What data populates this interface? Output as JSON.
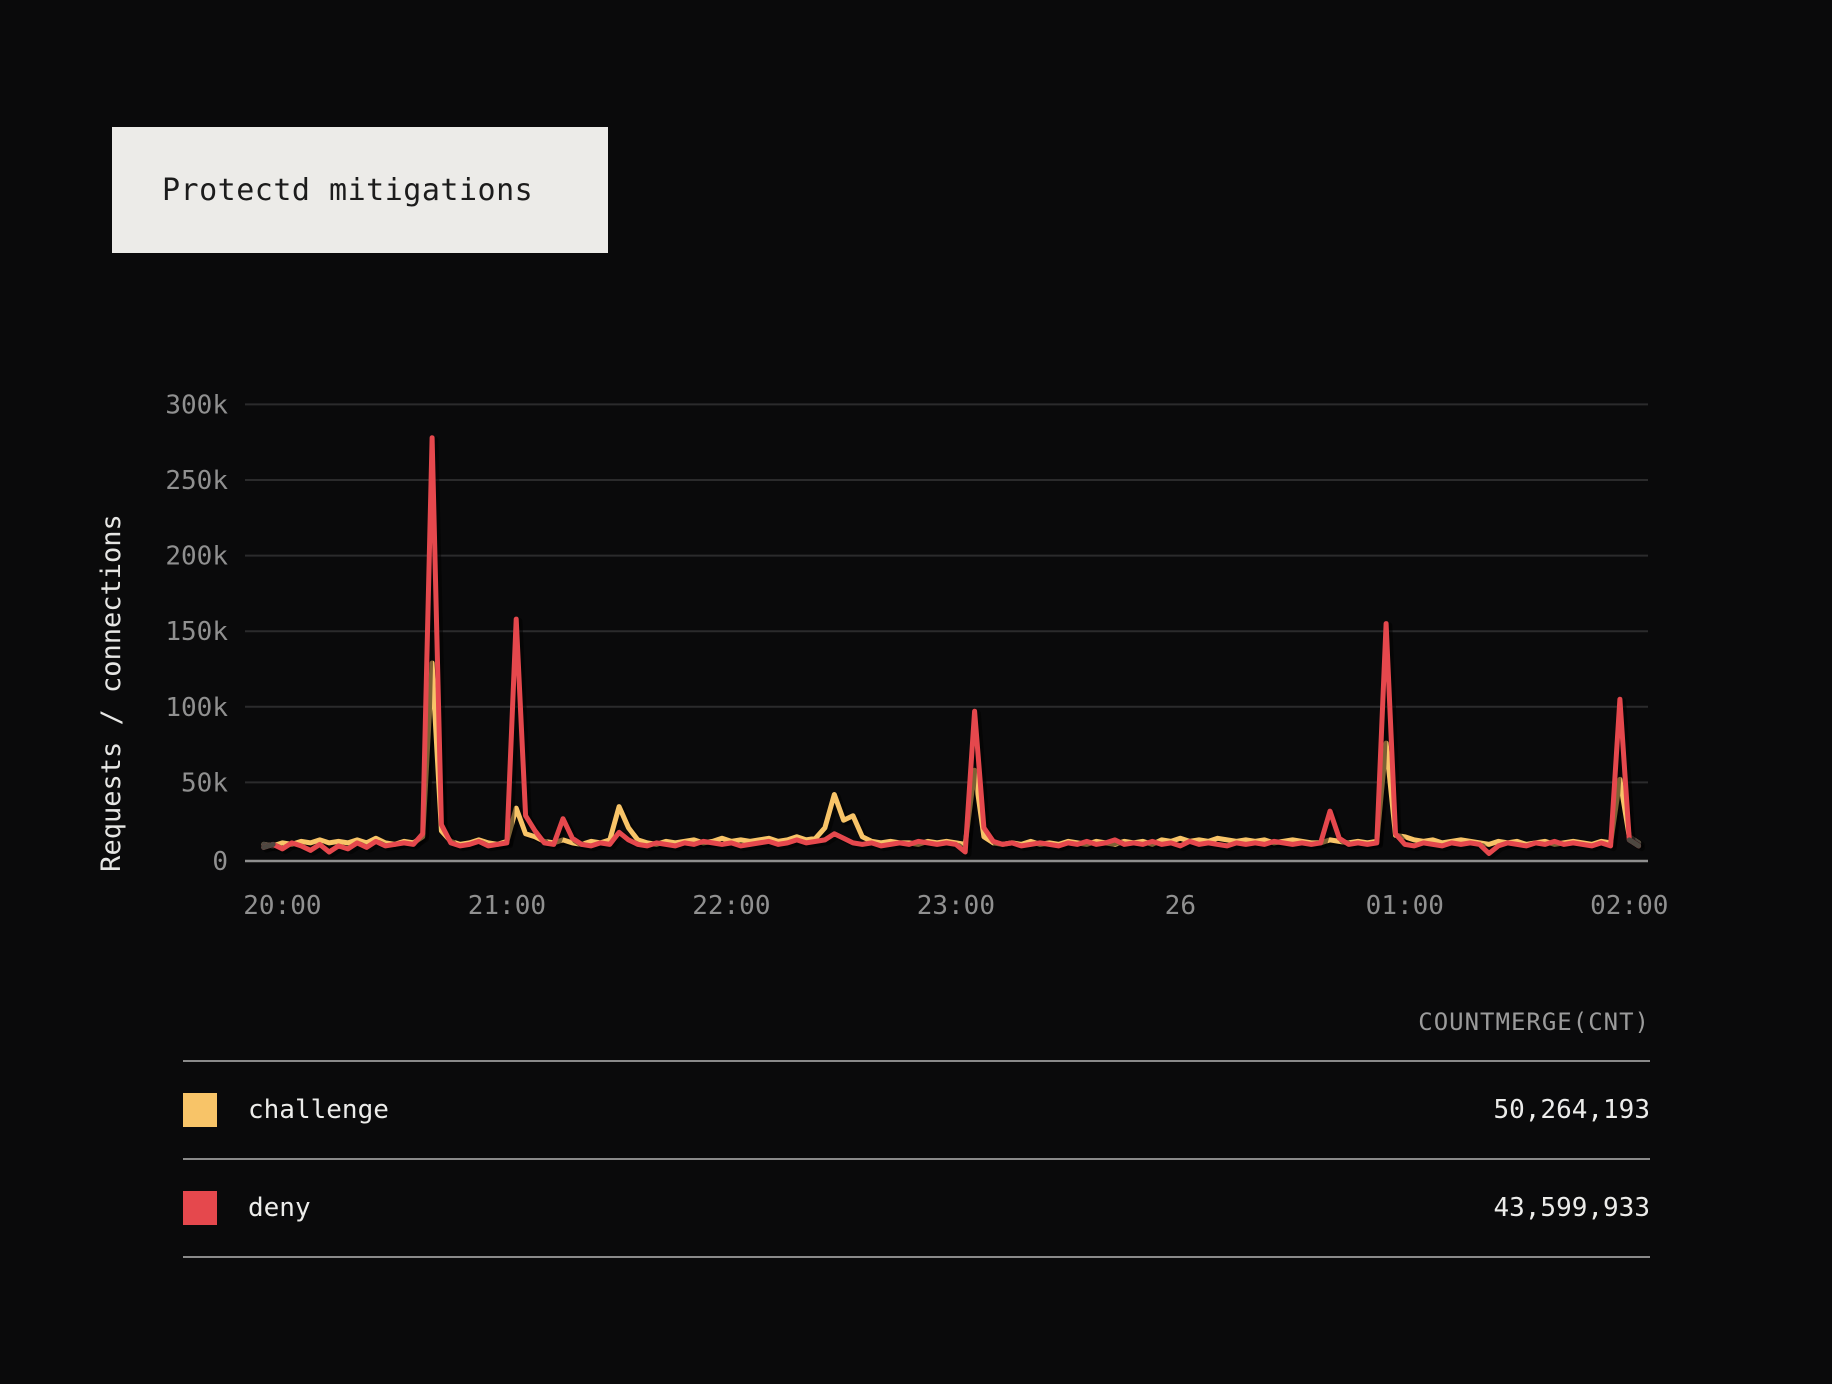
{
  "header": {
    "title": "Protectd mitigations"
  },
  "chart_data": {
    "type": "line",
    "title": "Protectd mitigations",
    "ylabel": "Requests / connections",
    "ylim": [
      0,
      300000
    ],
    "grid": true,
    "legend_position": "bottom-table",
    "x_unit": "minutes after 19:50; ticks are hourly times, '26' marks midnight (date 26)",
    "x_domain_min": [
      0,
      375
    ],
    "y_ticks": [
      {
        "v_k": 0,
        "label": "0"
      },
      {
        "v_k": 50,
        "label": "50k"
      },
      {
        "v_k": 100,
        "label": "100k"
      },
      {
        "v_k": 150,
        "label": "150k"
      },
      {
        "v_k": 200,
        "label": "200k"
      },
      {
        "v_k": 250,
        "label": "250k"
      },
      {
        "v_k": 300,
        "label": "300k"
      }
    ],
    "x_ticks": [
      {
        "t": 10,
        "label": "20:00"
      },
      {
        "t": 70,
        "label": "21:00"
      },
      {
        "t": 130,
        "label": "22:00"
      },
      {
        "t": 190,
        "label": "23:00"
      },
      {
        "t": 250,
        "label": "26"
      },
      {
        "t": 310,
        "label": "01:00"
      },
      {
        "t": 370,
        "label": "02:00"
      }
    ],
    "series": [
      {
        "name": "challenge",
        "color": "#F8C468",
        "total": "50,264,193",
        "start_min": 5,
        "step_min": 2.5,
        "values_k": [
          9,
          8,
          10,
          9,
          11,
          10,
          12,
          10,
          11,
          10,
          12,
          10,
          13,
          10,
          9,
          11,
          10,
          14,
          129,
          18,
          11,
          9,
          10,
          12,
          10,
          9,
          11,
          33,
          16,
          14,
          11,
          10,
          12,
          10,
          9,
          11,
          10,
          12,
          34,
          20,
          12,
          10,
          9,
          11,
          10,
          11,
          12,
          10,
          11,
          13,
          11,
          12,
          11,
          12,
          13,
          11,
          12,
          14,
          12,
          13,
          20,
          42,
          25,
          28,
          14,
          11,
          10,
          11,
          10,
          10,
          9,
          11,
          10,
          11,
          10,
          9,
          58,
          14,
          10,
          9,
          10,
          9,
          11,
          9,
          10,
          9,
          11,
          10,
          9,
          11,
          10,
          9,
          11,
          10,
          11,
          9,
          12,
          11,
          13,
          11,
          12,
          11,
          13,
          12,
          11,
          12,
          11,
          12,
          10,
          11,
          12,
          11,
          10,
          10,
          12,
          11,
          10,
          11,
          10,
          11,
          76,
          15,
          14,
          12,
          11,
          12,
          10,
          11,
          12,
          11,
          10,
          9,
          11,
          10,
          11,
          9,
          10,
          11,
          9,
          10,
          11,
          10,
          9,
          11,
          10,
          52,
          14,
          10
        ]
      },
      {
        "name": "deny",
        "color": "#E5484D",
        "total": "43,599,933",
        "start_min": 5,
        "step_min": 2.5,
        "values_k": [
          7,
          9,
          6,
          10,
          8,
          5,
          9,
          4,
          8,
          6,
          10,
          7,
          11,
          8,
          9,
          10,
          9,
          16,
          278,
          22,
          10,
          8,
          9,
          11,
          8,
          9,
          10,
          158,
          28,
          18,
          10,
          9,
          26,
          13,
          9,
          8,
          10,
          9,
          17,
          12,
          9,
          8,
          10,
          9,
          8,
          10,
          9,
          11,
          10,
          9,
          10,
          8,
          9,
          10,
          11,
          9,
          10,
          12,
          10,
          11,
          12,
          16,
          13,
          10,
          9,
          10,
          8,
          9,
          10,
          9,
          11,
          10,
          9,
          10,
          9,
          4,
          97,
          20,
          11,
          9,
          10,
          8,
          9,
          10,
          9,
          8,
          10,
          9,
          11,
          9,
          10,
          12,
          9,
          10,
          9,
          11,
          9,
          10,
          8,
          11,
          9,
          10,
          9,
          8,
          10,
          9,
          10,
          9,
          11,
          10,
          9,
          10,
          9,
          10,
          31,
          13,
          9,
          10,
          9,
          10,
          155,
          16,
          9,
          8,
          10,
          9,
          8,
          10,
          9,
          10,
          9,
          3,
          8,
          10,
          9,
          8,
          10,
          9,
          11,
          9,
          10,
          9,
          8,
          10,
          8,
          105,
          12,
          8
        ]
      }
    ]
  },
  "legend": {
    "header": "COUNTMERGE(CNT)",
    "rows": [
      {
        "label": "challenge",
        "value": "50,264,193",
        "color": "#F8C468"
      },
      {
        "label": "deny",
        "value": "43,599,933",
        "color": "#E5484D"
      }
    ]
  },
  "colors": {
    "background": "#0A0A0B",
    "title_card_bg": "#ECEBE8",
    "title_text": "#1C1C1C",
    "gridline": "#2B2B2C",
    "axis_line": "#8F8F8F",
    "tick_label": "#909090",
    "axis_title": "#E6E6E4",
    "legend_text": "#ECECEA",
    "legend_header": "#9B9B9B",
    "series_end_cap": "#4D4740"
  }
}
